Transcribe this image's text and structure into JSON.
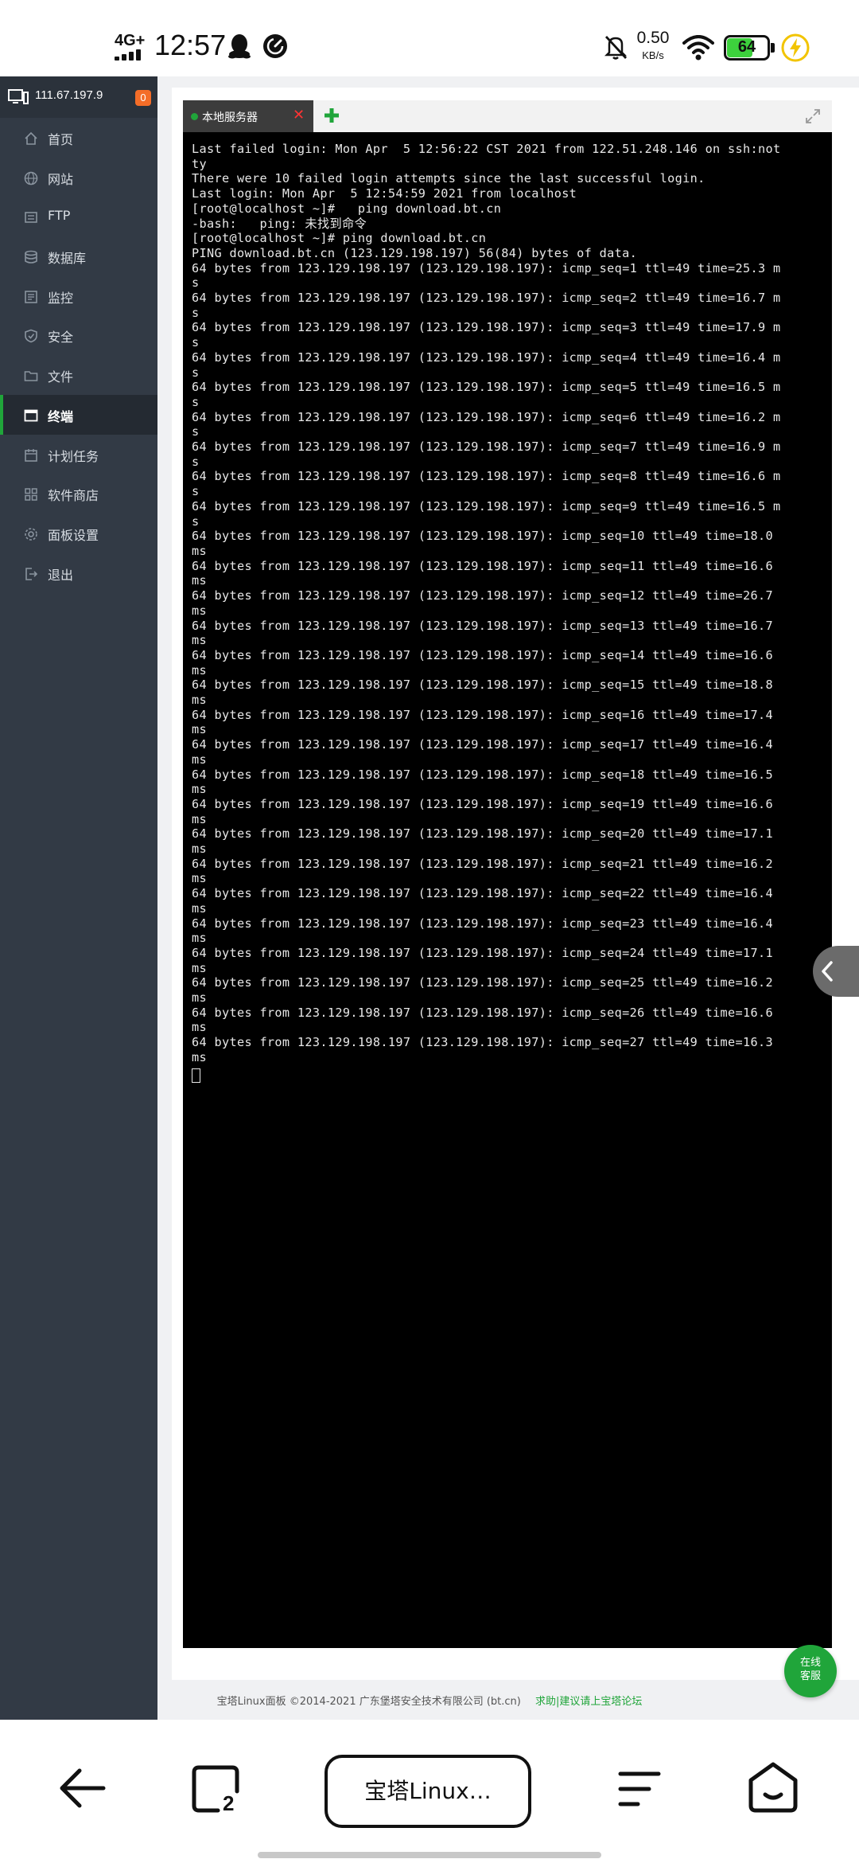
{
  "status_bar": {
    "network": "4G+",
    "time": "12:57",
    "speed_value": "0.50",
    "speed_unit": "KB/s",
    "battery_percent": "64",
    "battery_level": 0.64,
    "icons": [
      "signal-icon",
      "qq-icon",
      "speedometer-icon",
      "mute-icon",
      "wifi-icon",
      "battery-icon",
      "charging-bolt-icon"
    ]
  },
  "sidebar": {
    "server_ip": "111.67.197.9",
    "alert_count": "0",
    "items": [
      {
        "label": "首页",
        "icon": "home-icon"
      },
      {
        "label": "网站",
        "icon": "globe-icon"
      },
      {
        "label": "FTP",
        "icon": "ftp-icon"
      },
      {
        "label": "数据库",
        "icon": "database-icon"
      },
      {
        "label": "监控",
        "icon": "monitor-icon"
      },
      {
        "label": "安全",
        "icon": "shield-icon"
      },
      {
        "label": "文件",
        "icon": "folder-icon"
      },
      {
        "label": "终端",
        "icon": "terminal-icon",
        "active": true
      },
      {
        "label": "计划任务",
        "icon": "calendar-icon"
      },
      {
        "label": "软件商店",
        "icon": "grid-icon"
      },
      {
        "label": "面板设置",
        "icon": "gear-icon"
      },
      {
        "label": "退出",
        "icon": "logout-icon"
      }
    ]
  },
  "terminal_tab": {
    "label": "本地服务器",
    "close": "✕"
  },
  "terminal": {
    "lines": [
      "Last failed login: Mon Apr  5 12:56:22 CST 2021 from 122.51.248.146 on ssh:not",
      "ty",
      "There were 10 failed login attempts since the last successful login.",
      "Last login: Mon Apr  5 12:54:59 2021 from localhost",
      "[root@localhost ~]#   ping download.bt.cn",
      "-bash:   ping: 未找到命令",
      "[root@localhost ~]# ping download.bt.cn",
      "PING download.bt.cn (123.129.198.197) 56(84) bytes of data.",
      "64 bytes from 123.129.198.197 (123.129.198.197): icmp_seq=1 ttl=49 time=25.3 m",
      "s",
      "64 bytes from 123.129.198.197 (123.129.198.197): icmp_seq=2 ttl=49 time=16.7 m",
      "s",
      "64 bytes from 123.129.198.197 (123.129.198.197): icmp_seq=3 ttl=49 time=17.9 m",
      "s",
      "64 bytes from 123.129.198.197 (123.129.198.197): icmp_seq=4 ttl=49 time=16.4 m",
      "s",
      "64 bytes from 123.129.198.197 (123.129.198.197): icmp_seq=5 ttl=49 time=16.5 m",
      "s",
      "64 bytes from 123.129.198.197 (123.129.198.197): icmp_seq=6 ttl=49 time=16.2 m",
      "s",
      "64 bytes from 123.129.198.197 (123.129.198.197): icmp_seq=7 ttl=49 time=16.9 m",
      "s",
      "64 bytes from 123.129.198.197 (123.129.198.197): icmp_seq=8 ttl=49 time=16.6 m",
      "s",
      "64 bytes from 123.129.198.197 (123.129.198.197): icmp_seq=9 ttl=49 time=16.5 m",
      "s",
      "64 bytes from 123.129.198.197 (123.129.198.197): icmp_seq=10 ttl=49 time=18.0",
      "ms",
      "64 bytes from 123.129.198.197 (123.129.198.197): icmp_seq=11 ttl=49 time=16.6",
      "ms",
      "64 bytes from 123.129.198.197 (123.129.198.197): icmp_seq=12 ttl=49 time=26.7",
      "ms",
      "64 bytes from 123.129.198.197 (123.129.198.197): icmp_seq=13 ttl=49 time=16.7",
      "ms",
      "64 bytes from 123.129.198.197 (123.129.198.197): icmp_seq=14 ttl=49 time=16.6",
      "ms",
      "64 bytes from 123.129.198.197 (123.129.198.197): icmp_seq=15 ttl=49 time=18.8",
      "ms",
      "64 bytes from 123.129.198.197 (123.129.198.197): icmp_seq=16 ttl=49 time=17.4",
      "ms",
      "64 bytes from 123.129.198.197 (123.129.198.197): icmp_seq=17 ttl=49 time=16.4",
      "ms",
      "64 bytes from 123.129.198.197 (123.129.198.197): icmp_seq=18 ttl=49 time=16.5",
      "ms",
      "64 bytes from 123.129.198.197 (123.129.198.197): icmp_seq=19 ttl=49 time=16.6",
      "ms",
      "64 bytes from 123.129.198.197 (123.129.198.197): icmp_seq=20 ttl=49 time=17.1",
      "ms",
      "64 bytes from 123.129.198.197 (123.129.198.197): icmp_seq=21 ttl=49 time=16.2",
      "ms",
      "64 bytes from 123.129.198.197 (123.129.198.197): icmp_seq=22 ttl=49 time=16.4",
      "ms",
      "64 bytes from 123.129.198.197 (123.129.198.197): icmp_seq=23 ttl=49 time=16.4",
      "ms",
      "64 bytes from 123.129.198.197 (123.129.198.197): icmp_seq=24 ttl=49 time=17.1",
      "ms",
      "64 bytes from 123.129.198.197 (123.129.198.197): icmp_seq=25 ttl=49 time=16.2",
      "ms",
      "64 bytes from 123.129.198.197 (123.129.198.197): icmp_seq=26 ttl=49 time=16.6",
      "ms",
      "64 bytes from 123.129.198.197 (123.129.198.197): icmp_seq=27 ttl=49 time=16.3",
      "ms"
    ]
  },
  "footer": {
    "copyright": "宝塔Linux面板 ©2014-2021 广东堡塔安全技术有限公司 (bt.cn)",
    "link": "求助|建议请上宝塔论坛"
  },
  "online_service": {
    "line1": "在线",
    "line2": "客服"
  },
  "browser_bar": {
    "tab_count": "2",
    "page_title": "宝塔Linux…"
  },
  "colors": {
    "brand_green": "#20a53a",
    "sidebar_bg": "#323a45",
    "terminal_bg": "#000000",
    "alert_orange": "#f46d28"
  }
}
